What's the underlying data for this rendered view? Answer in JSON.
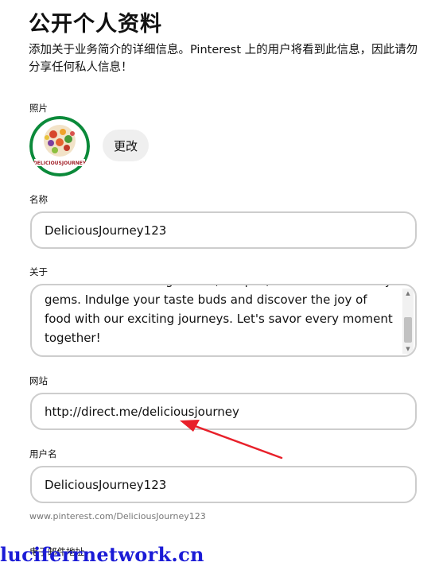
{
  "page": {
    "title": "公开个人资料",
    "intro": "添加关于业务简介的详细信息。Pinterest 上的用户将看到此信息，因此请勿分享任何私人信息！"
  },
  "photo": {
    "label": "照片",
    "avatar_text": "DELICIOUSJOURNEY",
    "change_label": "更改"
  },
  "name": {
    "label": "名称",
    "value": "DeliciousJourney123"
  },
  "about": {
    "label": "关于",
    "value": "as for mouthwatering dishes, recipes, and hidden culinary gems. Indulge your taste buds and discover the joy of food with our exciting journeys. Let's savor every moment together!"
  },
  "website": {
    "label": "网站",
    "value": "http://direct.me/deliciousjourney"
  },
  "username": {
    "label": "用户名",
    "value": "DeliciousJourney123",
    "profile_url": "www.pinterest.com/DeliciousJourney123"
  },
  "email": {
    "label": "电子邮件地址"
  },
  "watermark": "luciferrnetwork.cn",
  "colors": {
    "arrow": "#e8202a",
    "watermark": "#1b1bd6",
    "avatar_ring": "#0b8a3a"
  }
}
